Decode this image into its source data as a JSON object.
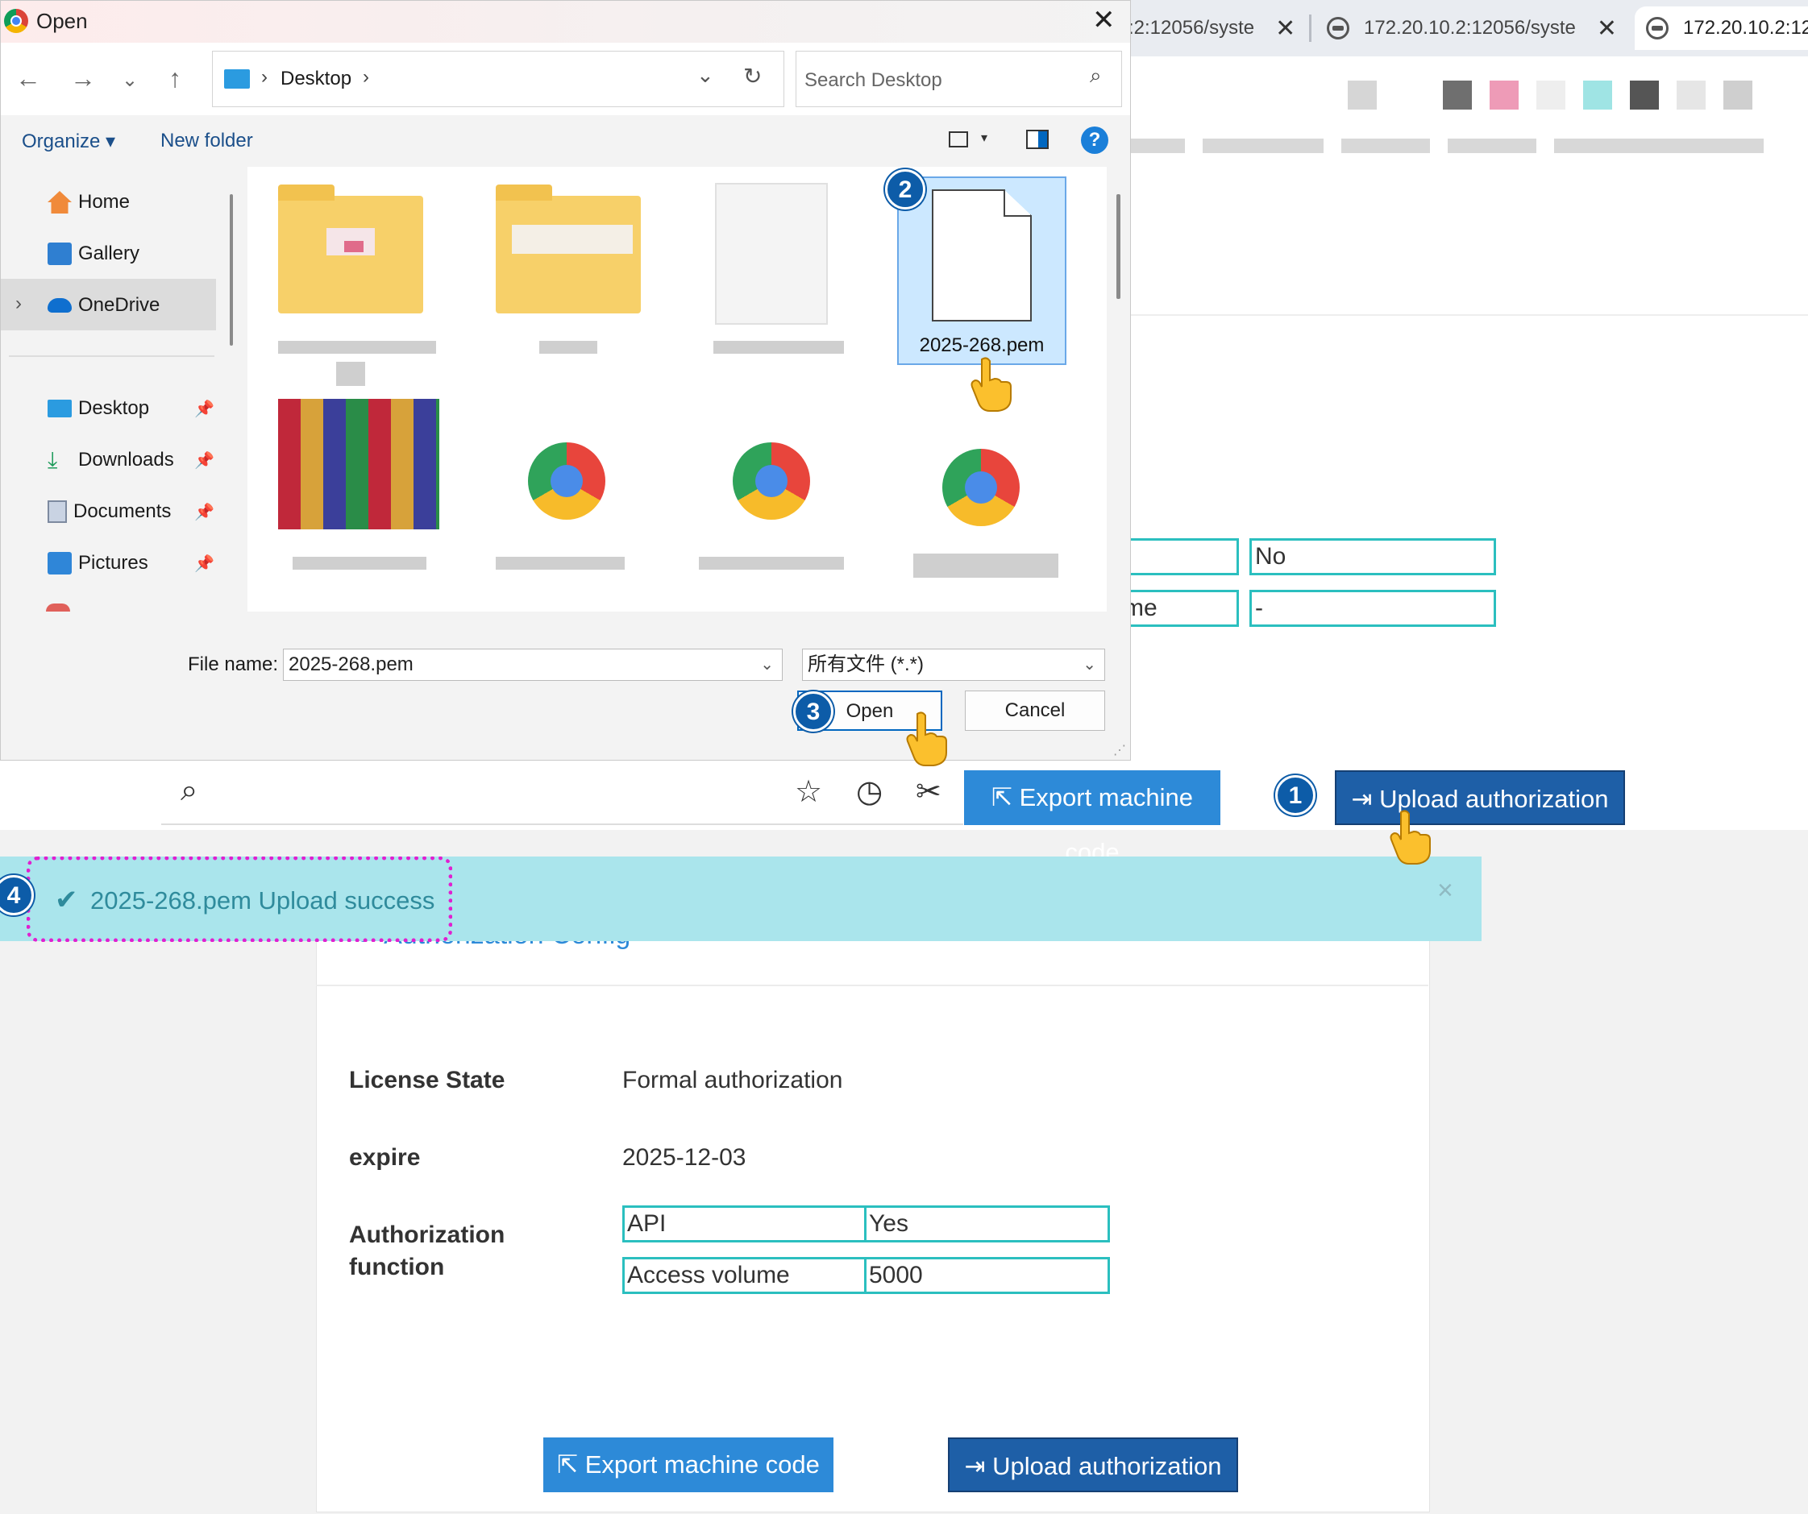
{
  "dialog": {
    "title": "Open",
    "breadcrumb": {
      "location": "Desktop",
      "sep1": "›",
      "sep2": "›"
    },
    "search_placeholder": "Search Desktop",
    "commands": {
      "organize": "Organize ▾",
      "new_folder": "New folder",
      "help": "?"
    },
    "nav": [
      {
        "label": "Home"
      },
      {
        "label": "Gallery"
      },
      {
        "label": "OneDrive",
        "expand": "›"
      },
      {
        "label": "Desktop"
      },
      {
        "label": "Downloads"
      },
      {
        "label": "Documents"
      },
      {
        "label": "Pictures"
      }
    ],
    "selected_file": "2025-268.pem",
    "file_name_label": "File name:",
    "file_name_value": "2025-268.pem",
    "file_type": "所有文件 (*.*)",
    "open_label": "Open",
    "cancel_label": "Cancel"
  },
  "browser_tabs": [
    {
      "label": ":2:12056/syste"
    },
    {
      "label": "172.20.10.2:12056/syste"
    },
    {
      "label": "172.20.10.2:12"
    }
  ],
  "background_table": {
    "row1_value": "No",
    "row2_label": "me",
    "row2_value": "-"
  },
  "buttons": {
    "export_machine_code": "Export machine code",
    "upload_authorization": "Upload authorization"
  },
  "alert": {
    "message": "2025-268.pem Upload success",
    "close": "×"
  },
  "card": {
    "title": "Authorization Config",
    "license_state_label": "License State",
    "license_state_value": "Formal authorization",
    "expire_label": "expire",
    "expire_value": "2025-12-03",
    "function_label_1": "Authorization",
    "function_label_2": "function",
    "functions": [
      {
        "name": "API",
        "value": "Yes"
      },
      {
        "name": "Access volume",
        "value": "5000"
      }
    ]
  },
  "markers": [
    "1",
    "2",
    "3",
    "4"
  ],
  "colors": {
    "primary_button": "#2d8ad8",
    "upload_button": "#1e5fa7",
    "alert_bg": "#aae5ec",
    "alert_text": "#2f8b9c",
    "table_border": "#2bbfbf",
    "highlight": "#e020d0",
    "marker": "#0d5ca8"
  }
}
